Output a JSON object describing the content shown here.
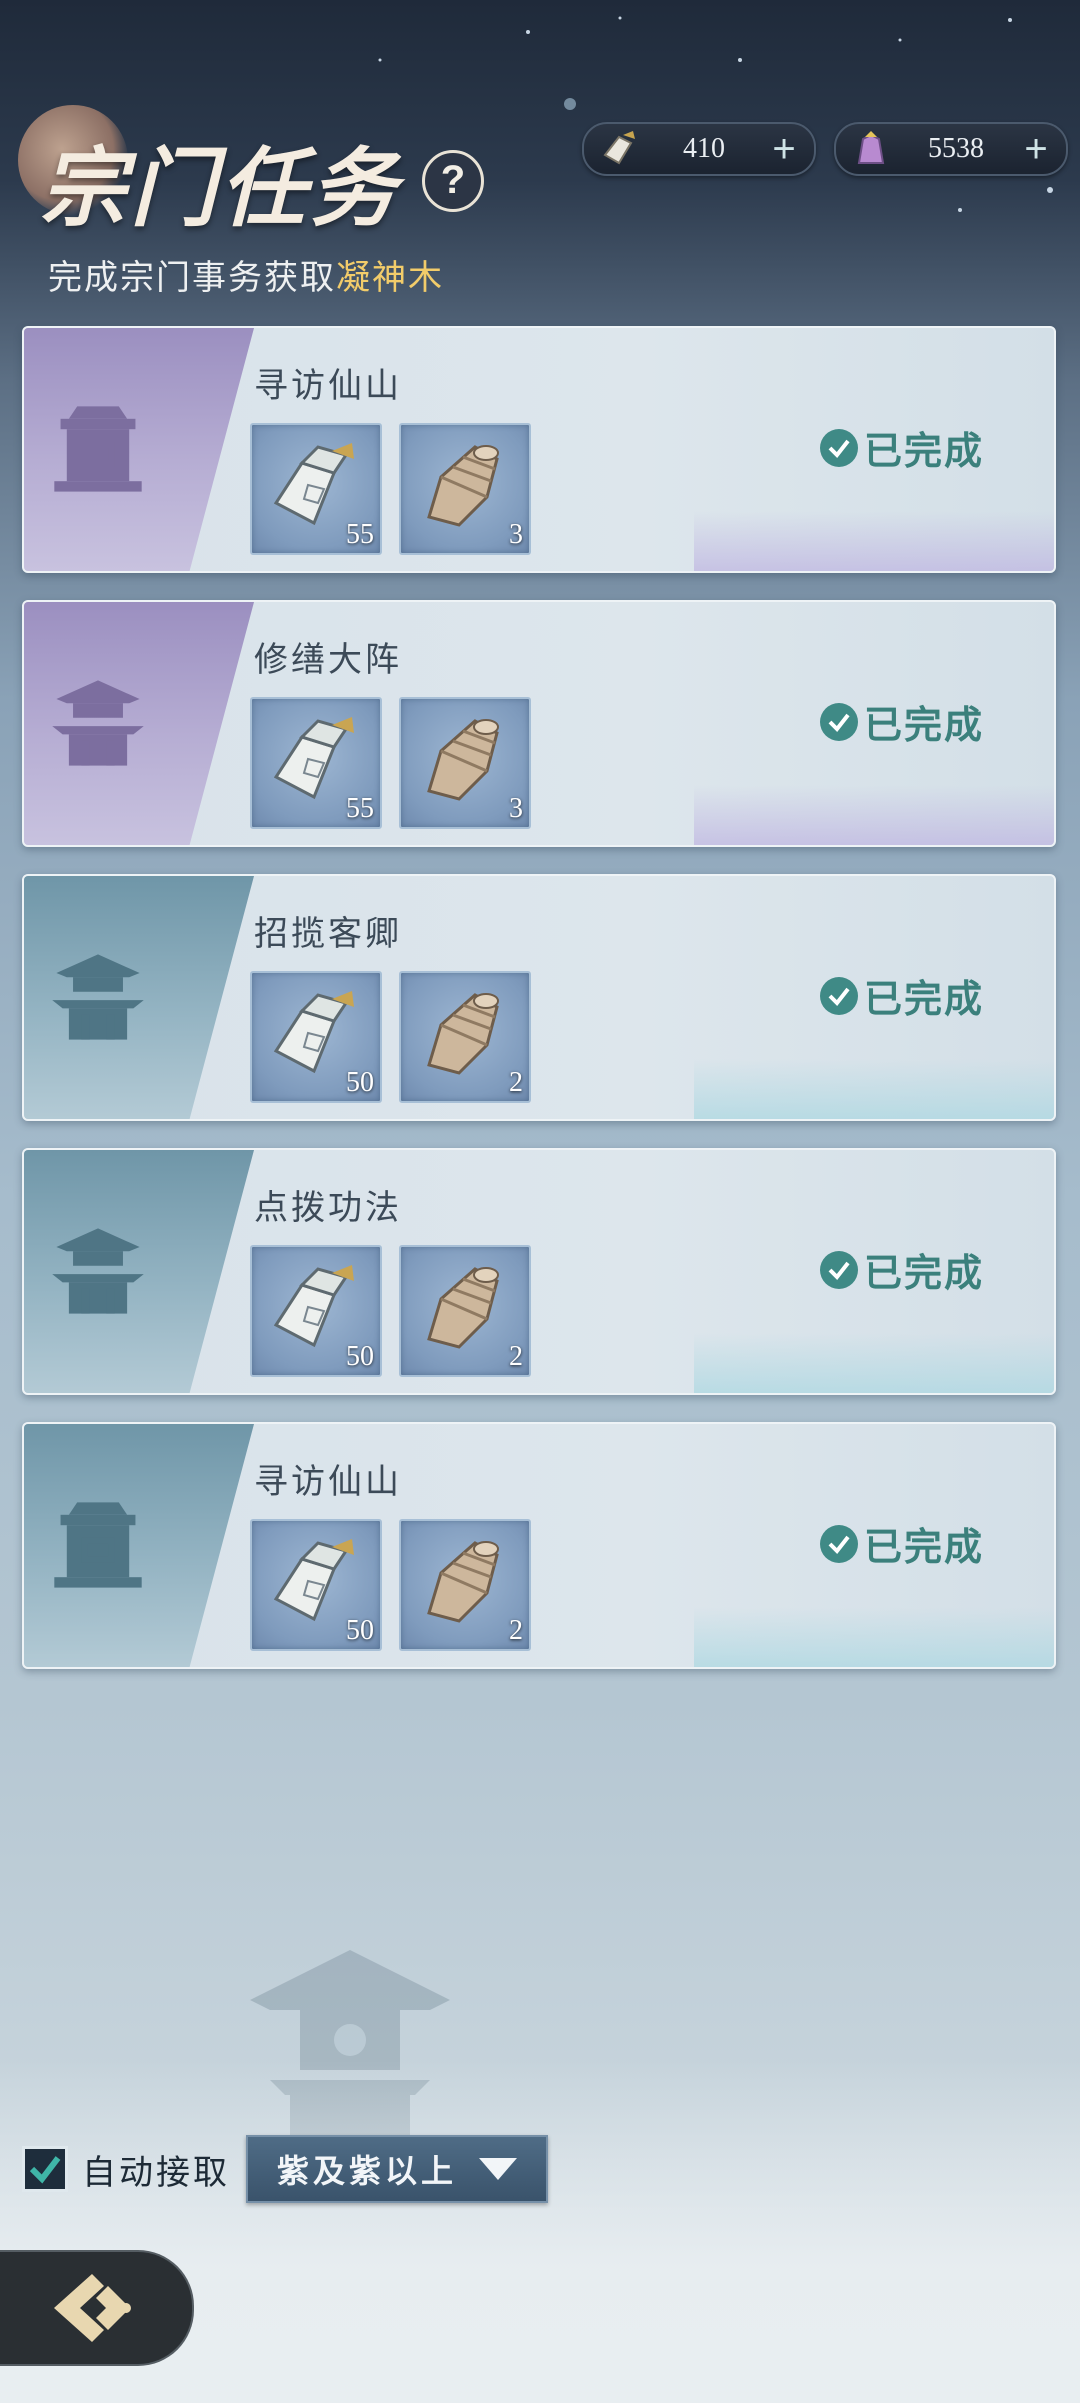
{
  "header": {
    "title": "宗门任务",
    "help_label": "?",
    "subtitle_prefix": "完成宗门事务获取",
    "subtitle_highlight": "凝神木",
    "highlight_color": "#f2cc6a"
  },
  "currencies": [
    {
      "icon": "scroll-token-icon",
      "value": "410",
      "plus": "+"
    },
    {
      "icon": "purple-robe-icon",
      "value": "5538",
      "plus": "+"
    }
  ],
  "tasks": [
    {
      "name": "寻访仙山",
      "rank_icon": "seal-icon",
      "tier": "purple",
      "rewards": [
        {
          "icon": "scroll-icon",
          "qty": "55"
        },
        {
          "icon": "wood-icon",
          "qty": "3"
        }
      ],
      "status": "已完成"
    },
    {
      "name": "修缮大阵",
      "rank_icon": "pagoda-icon",
      "tier": "purple",
      "rewards": [
        {
          "icon": "scroll-icon",
          "qty": "55"
        },
        {
          "icon": "wood-icon",
          "qty": "3"
        }
      ],
      "status": "已完成"
    },
    {
      "name": "招揽客卿",
      "rank_icon": "pagoda-icon",
      "tier": "teal",
      "rewards": [
        {
          "icon": "scroll-icon",
          "qty": "50"
        },
        {
          "icon": "wood-icon",
          "qty": "2"
        }
      ],
      "status": "已完成"
    },
    {
      "name": "点拨功法",
      "rank_icon": "pagoda-icon",
      "tier": "teal",
      "rewards": [
        {
          "icon": "scroll-icon",
          "qty": "50"
        },
        {
          "icon": "wood-icon",
          "qty": "2"
        }
      ],
      "status": "已完成"
    },
    {
      "name": "寻访仙山",
      "rank_icon": "seal-icon",
      "tier": "teal",
      "rewards": [
        {
          "icon": "scroll-icon",
          "qty": "50"
        },
        {
          "icon": "wood-icon",
          "qty": "2"
        }
      ],
      "status": "已完成"
    }
  ],
  "auto_accept": {
    "checked": true,
    "label": "自动接取",
    "dropdown_value": "紫及紫以上"
  },
  "colors": {
    "status_green": "#3b807c",
    "purple_tier": "#9b8fc0",
    "teal_tier": "#6f96a8"
  }
}
